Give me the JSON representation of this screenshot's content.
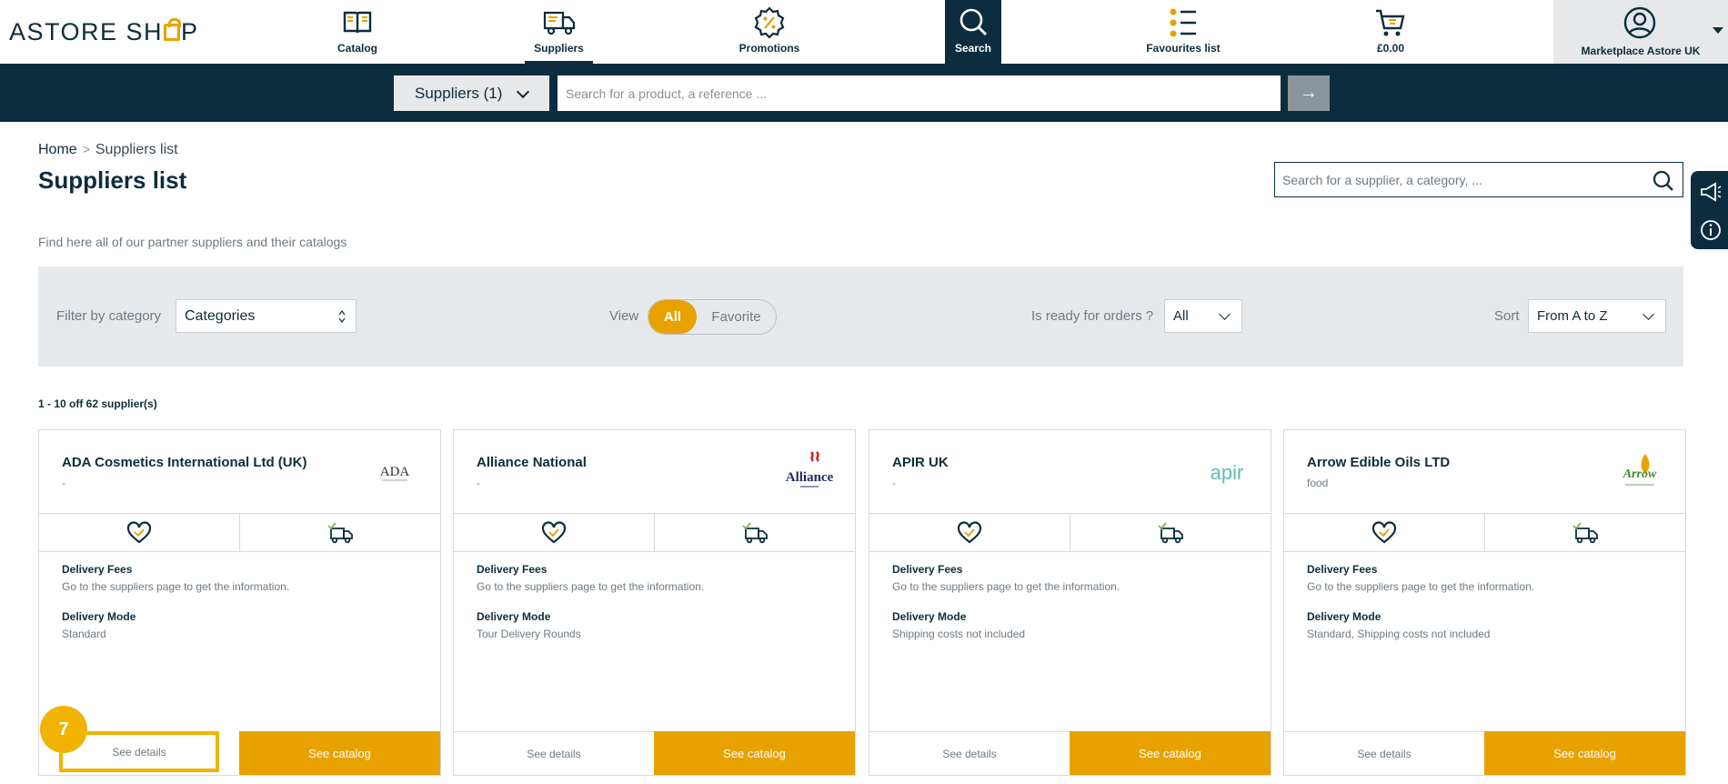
{
  "brand": {
    "logo_pre": "ASTORE SH",
    "logo_post": "P",
    "accent": "#e8a200",
    "navy": "#0c2d3e"
  },
  "nav": [
    {
      "label": "Catalog",
      "icon": "book-icon"
    },
    {
      "label": "Suppliers",
      "icon": "truck-icon"
    },
    {
      "label": "Promotions",
      "icon": "percent-badge-icon"
    },
    {
      "label": "Search",
      "icon": "search-icon"
    },
    {
      "label": "Favourites list",
      "icon": "list-icon"
    },
    {
      "label": "£0.00",
      "icon": "cart-icon"
    }
  ],
  "account": {
    "label": "Marketplace Astore UK",
    "icon": "user-icon"
  },
  "search": {
    "scope_label": "Suppliers (1)",
    "placeholder": "Search for a product, a reference ...",
    "go_label": "→"
  },
  "breadcrumb": {
    "home": "Home",
    "sep": ">",
    "current": "Suppliers list"
  },
  "page": {
    "title": "Suppliers list",
    "intro": "Find here all of our partner suppliers and their catalogs",
    "supplier_search_placeholder": "Search for a supplier, a category, ..."
  },
  "filters": {
    "category_label": "Filter by category",
    "category_value": "Categories",
    "view_label": "View",
    "view_all": "All",
    "view_favorite": "Favorite",
    "ready_label": "Is ready for orders ?",
    "ready_value": "All",
    "sort_label": "Sort",
    "sort_value": "From A to Z"
  },
  "results": {
    "count_text": "1 - 10 off 62 supplier(s)"
  },
  "labels": {
    "delivery_fees": "Delivery Fees",
    "delivery_mode": "Delivery Mode",
    "see_details": "See details",
    "see_catalog": "See catalog"
  },
  "suppliers": [
    {
      "name": "ADA Cosmetics International Ltd (UK)",
      "category": "-",
      "fees": "Go to the suppliers page to get the information.",
      "mode": "Standard",
      "logo_text": "ADA"
    },
    {
      "name": "Alliance National",
      "category": "-",
      "fees": "Go to the suppliers page to get the information.",
      "mode": "Tour Delivery Rounds",
      "logo_text": "Alliance"
    },
    {
      "name": "APIR UK",
      "category": "-",
      "fees": "Go to the suppliers page to get the information.",
      "mode": "Shipping costs not included",
      "logo_text": "apir"
    },
    {
      "name": "Arrow Edible Oils LTD",
      "category": "food",
      "fees": "Go to the suppliers page to get the information.",
      "mode": "Standard, Shipping costs not included",
      "logo_text": "Arrow"
    }
  ],
  "step_badge": "7"
}
